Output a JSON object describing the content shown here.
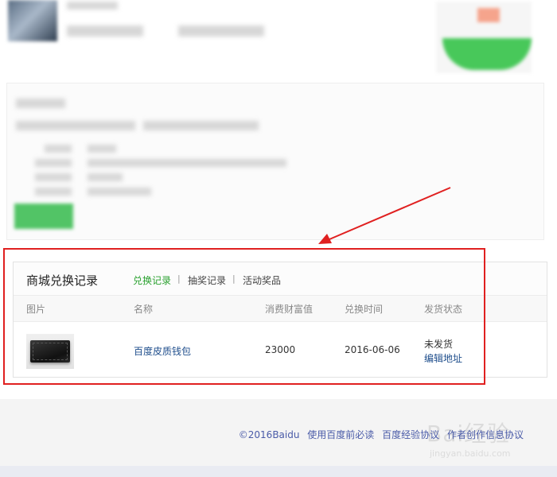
{
  "panel": {
    "title": "商城兑换记录",
    "tabs": [
      {
        "label": "兑换记录",
        "active": true
      },
      {
        "label": "抽奖记录",
        "active": false
      },
      {
        "label": "活动奖品",
        "active": false
      }
    ],
    "tab_separator": "|",
    "columns": [
      "图片",
      "名称",
      "消费财富值",
      "兑换时间",
      "发货状态"
    ],
    "rows": [
      {
        "image_icon": "wallet-icon",
        "name": "百度皮质钱包",
        "cost": "23000",
        "date": "2016-06-06",
        "status": "未发货",
        "action": "编辑地址"
      }
    ]
  },
  "footer": {
    "copyright": "©2016Baidu",
    "links": [
      "使用百度前必读",
      "百度经验协议",
      "作者创作信息协议"
    ]
  },
  "watermark": {
    "text": "Bai经验",
    "sub": "jingyan.baidu.com"
  },
  "colors": {
    "active_tab": "#2aa12f",
    "link": "#1f4e8c",
    "annotation": "#e02020",
    "footer_link": "#4a5ba8"
  }
}
